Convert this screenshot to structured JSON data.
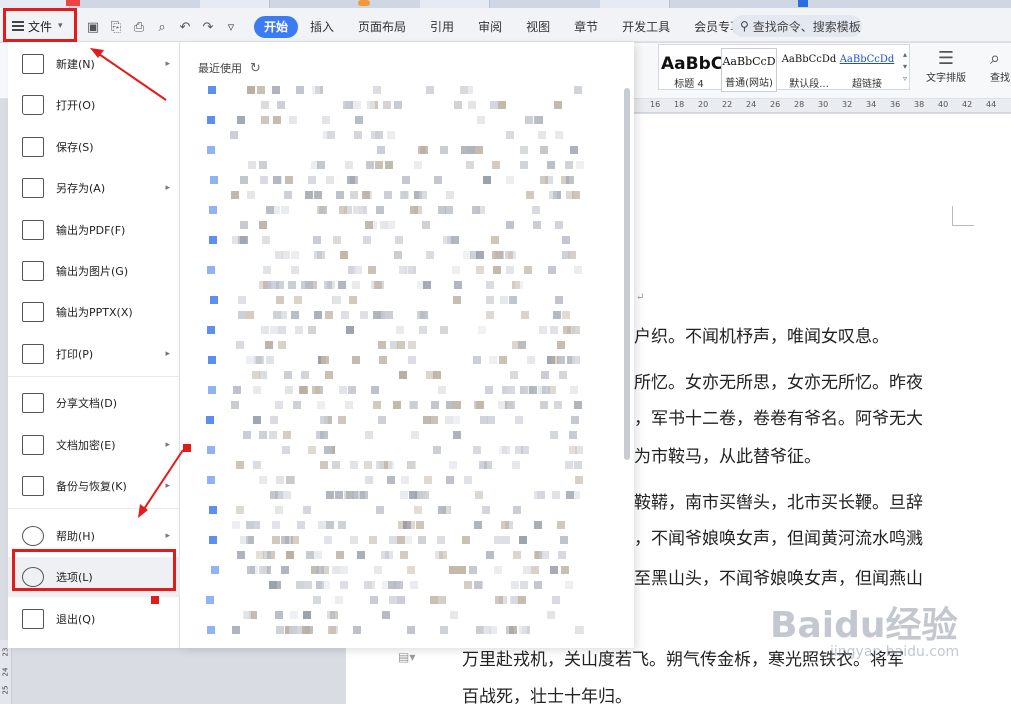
{
  "menubar": {
    "file_label": "文件",
    "tabs": [
      "开始",
      "插入",
      "页面布局",
      "引用",
      "审阅",
      "视图",
      "章节",
      "开发工具",
      "会员专享"
    ],
    "search_label": "查找命令、搜索模板"
  },
  "ribbon": {
    "styles": [
      {
        "sample": "AaBbC",
        "label": "标题 4"
      },
      {
        "sample": "AaBbCcD",
        "label": "普通(网站)"
      },
      {
        "sample": "AaBbCcDd",
        "label": "默认段..."
      },
      {
        "sample": "AaBbCcDd",
        "label": "超链接"
      }
    ],
    "text_layout": "文字排版",
    "lookup": "查找"
  },
  "ruler": {
    "ticks": [
      "16",
      "18",
      "20",
      "22",
      "24",
      "26",
      "28",
      "30",
      "32",
      "34",
      "36",
      "38",
      "40",
      "42",
      "44"
    ]
  },
  "vruler": [
    "25",
    "24",
    "23"
  ],
  "file_menu": {
    "items": [
      {
        "label": "新建(N)",
        "arrow": true
      },
      {
        "label": "打开(O)",
        "arrow": false
      },
      {
        "label": "保存(S)",
        "arrow": false
      },
      {
        "label": "另存为(A)",
        "arrow": true
      },
      {
        "label": "输出为PDF(F)",
        "arrow": false
      },
      {
        "label": "输出为图片(G)",
        "arrow": false
      },
      {
        "label": "输出为PPTX(X)",
        "arrow": false
      },
      {
        "label": "打印(P)",
        "arrow": true
      },
      {
        "label": "分享文档(D)",
        "arrow": false
      },
      {
        "label": "文档加密(E)",
        "arrow": true
      },
      {
        "label": "备份与恢复(K)",
        "arrow": true
      },
      {
        "label": "帮助(H)",
        "arrow": true
      },
      {
        "label": "选项(L)",
        "arrow": false
      },
      {
        "label": "退出(Q)",
        "arrow": false
      }
    ]
  },
  "recent": {
    "header": "最近使用"
  },
  "document": {
    "lines": [
      "户织。不闻机杼声，唯闻女叹息。",
      "所忆。女亦无所思，女亦无所忆。昨夜",
      "，军书十二卷，卷卷有爷名。阿爷无大",
      "为市鞍马，从此替爷征。",
      "鞍鞯，南市买辔头，北市买长鞭。旦辞",
      "，不闻爷娘唤女声，但闻黄河流水鸣溅",
      "至黑山头，不闻爷娘唤女声，但闻燕山",
      "万里赴戎机，关山度若飞。朔气传金柝，寒光照铁衣。将军",
      "百战死，壮士十年归。"
    ]
  },
  "watermark": {
    "text": "Baidu经验",
    "sub": "jingyan.baidu.com"
  }
}
